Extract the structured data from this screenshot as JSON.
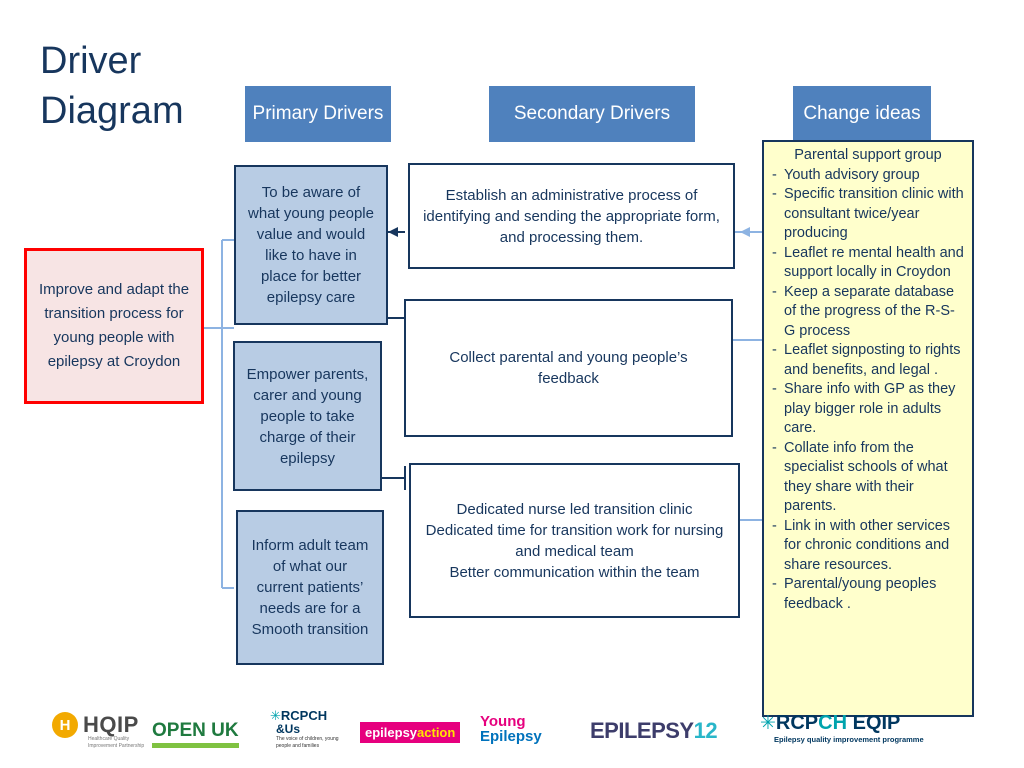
{
  "title": "Driver Diagram",
  "headers": {
    "primary": "Primary Drivers",
    "secondary": "Secondary Drivers",
    "change": "Change ideas"
  },
  "aim": "Improve and adapt the transition process for young people with epilepsy at Croydon",
  "primary_drivers": [
    "To be aware of what young people value and would like to have in place for better epilepsy care",
    "Empower parents, carer and  young people to take charge of their epilepsy",
    "Inform adult team of what our current patients’ needs are for a Smooth transition"
  ],
  "secondary_drivers": [
    "Establish an administrative process of identifying and sending the appropriate form, and processing them.",
    "Collect parental and young people’s feedback",
    "Dedicated nurse led transition clinic\nDedicated time for transition work for nursing and medical team\nBetter communication within the team"
  ],
  "change_ideas": {
    "intro": "Parental support group",
    "items": [
      {
        "style": "dash",
        "text": "Youth advisory group"
      },
      {
        "style": "dash",
        "text": "Specific transition clinic with consultant twice/year producing"
      },
      {
        "style": "dash",
        "text": "Leaflet re mental health and support locally in Croydon"
      },
      {
        "style": "dash",
        "text": "Keep a separate database of the progress of the R-S-G process"
      },
      {
        "style": "dash",
        "text": "Leaflet signposting to rights and benefits, and legal ."
      },
      {
        "style": "dash",
        "text": "Share info with GP as they play bigger role in adults care."
      },
      {
        "style": "dash",
        "text": "Collate info from the specialist schools of what they share with their parents."
      },
      {
        "style": "dash",
        "text": "Link in with other services for chronic conditions and share resources."
      },
      {
        "style": "dash",
        "text": "Parental/young peoples feedback ."
      }
    ]
  },
  "footer_logos": {
    "hqip": {
      "mark": "H",
      "name": "HQIP",
      "sub": "Healthcare Quality Improvement Partnership"
    },
    "openuk": {
      "open": "OPEN",
      "uk": " UK"
    },
    "rcpch_us": {
      "name": "RCPCH",
      "us": "&Us",
      "sub": "The voice of children, young people and families"
    },
    "epilepsy_action": {
      "main": "epilepsy",
      "accent": "action"
    },
    "young_epilepsy": {
      "line1": "Young",
      "line2": "Epilepsy"
    },
    "epilepsy12": {
      "word": "EPILEPSY",
      "number": "12"
    },
    "rcpch_eqip": {
      "r": "RCP",
      "ch": "CH",
      "eqip": " EQIP",
      "sub": "Epilepsy quality improvement programme"
    }
  },
  "colors": {
    "header_blue": "#4f81bd",
    "primary_fill": "#b8cce4",
    "dark_blue": "#17365d",
    "aim_border": "#ff0000",
    "change_fill": "#ffffcc"
  }
}
